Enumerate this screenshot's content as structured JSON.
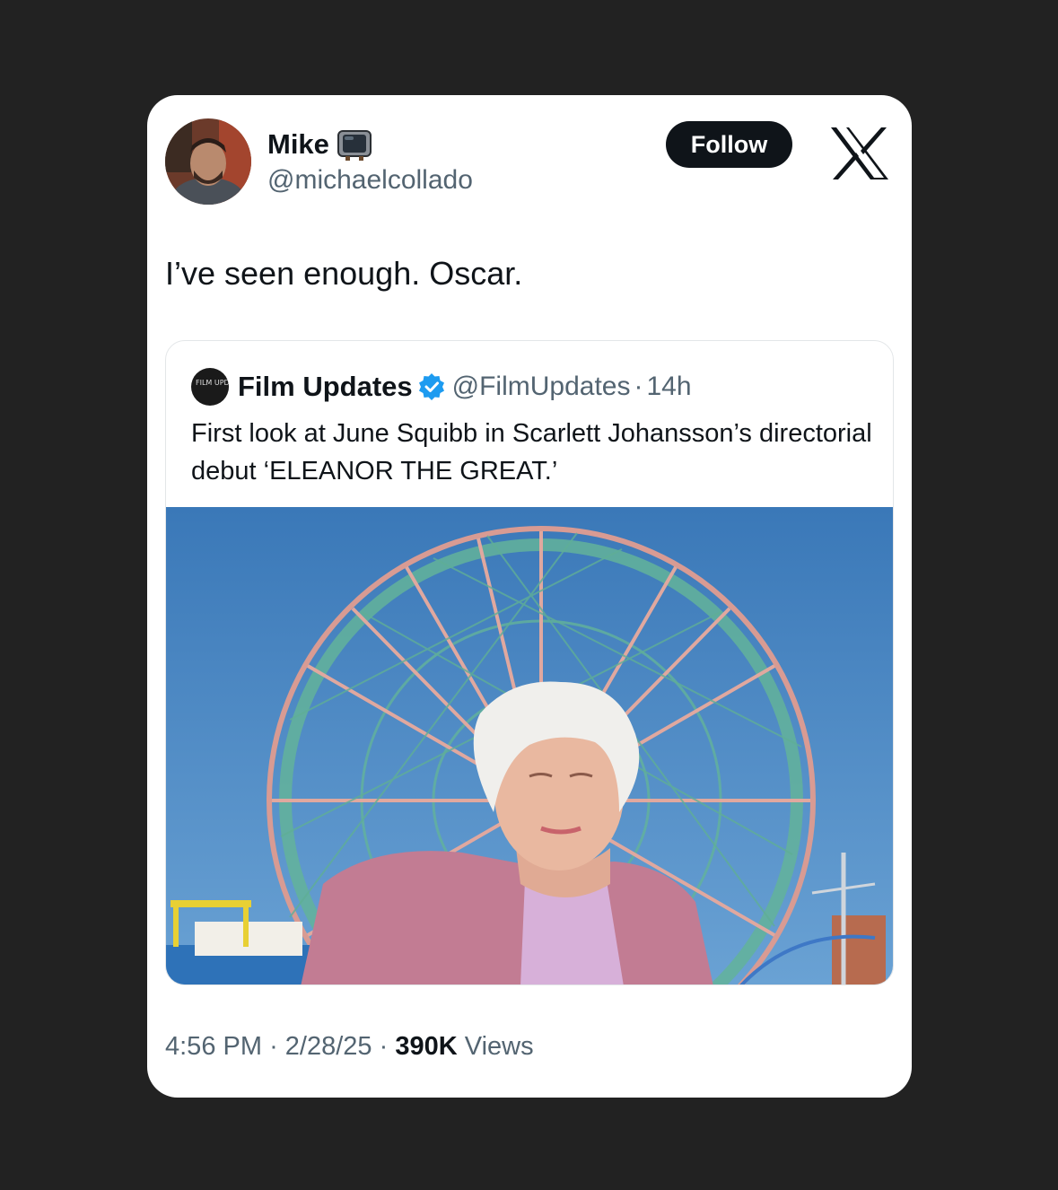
{
  "author": {
    "name": "Mike",
    "name_emoji_icon": "television-icon",
    "handle": "@michaelcollado"
  },
  "follow_label": "Follow",
  "tweet_text": "I’ve seen enough. Oscar.",
  "quote": {
    "name": "Film Updates",
    "avatar_text": "FILM UPDATES",
    "handle": "@FilmUpdates",
    "separator": "·",
    "time": "14h",
    "text": "First look at June Squibb in Scarlett Johansson’s directorial debut ‘ELEANOR THE GREAT.’"
  },
  "footer": {
    "time": "4:56 PM",
    "sep1": "·",
    "date": "2/28/25",
    "sep2": "·",
    "views_count": "390K",
    "views_label": "Views"
  },
  "colors": {
    "background": "#222222",
    "card": "#ffffff",
    "follow_button": "#0f1419",
    "verified": "#1d9bf0",
    "secondary_text": "#536471"
  }
}
